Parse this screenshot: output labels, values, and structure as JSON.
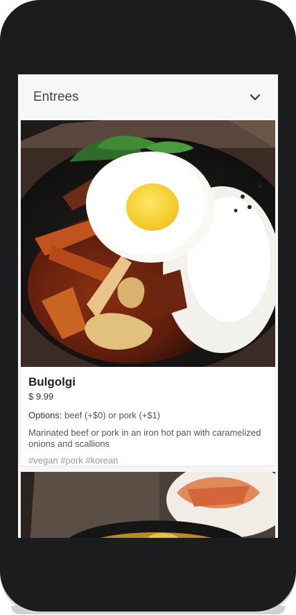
{
  "header": {
    "title": "Entrees",
    "toggle_icon": "chevron-down-icon"
  },
  "items": [
    {
      "name": "Bulgolgi",
      "price": "$ 9.99",
      "options_label": "Options:",
      "options_value": "beef (+$0) or pork (+$1)",
      "description": "Marinated beef or pork in an iron hot pan with caramelized onions and scallions",
      "tags": "#vegan #pork #korean"
    }
  ],
  "colors": {
    "phone_frame": "#1b1c1e",
    "screen_bg": "#f7f7f7",
    "card_bg": "#ffffff",
    "tag_text": "#999999"
  }
}
